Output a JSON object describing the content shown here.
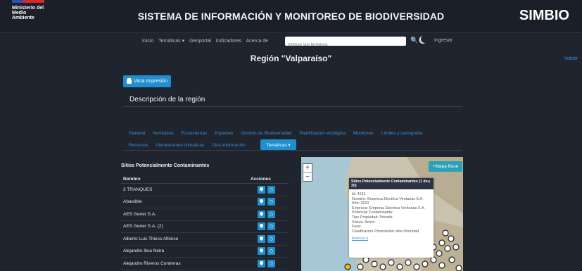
{
  "header": {
    "ministry_lines": [
      "Ministerio del",
      "Medio",
      "Ambiente"
    ],
    "title": "SISTEMA DE INFORMACIÓN Y MONITOREO DE BIODIVERSIDAD",
    "brand": "SIMBIO"
  },
  "nav": {
    "items": [
      "Inicio",
      "Temáticas ▾",
      "Geoportal",
      "Indicadores",
      "Acerca de"
    ],
    "search_placeholder": "Ingrese sus términos.",
    "login": "Ingresar"
  },
  "page": {
    "title": "Región \"Valparaíso\"",
    "back": "Volver",
    "print_button": "Vista Impresión",
    "section_title": "Descripción de la región"
  },
  "tabs": {
    "row1": [
      "General",
      "Normativa",
      "Ecosistemas",
      "Especies",
      "Gestión de Biodiversidad",
      "Planificación ecológica",
      "Monitoreo",
      "Límites y cartografía"
    ],
    "row2": [
      "Recursos",
      "Simulaciones climáticas",
      "Otra información"
    ],
    "active": "Temáticas ▾"
  },
  "table": {
    "title": "Sitios Potencialmente Contaminantes",
    "headers": [
      "Nombre",
      "Acciones"
    ],
    "rows": [
      "3 TRANQUES",
      "Abastible",
      "AES Gener S.A.",
      "AES Gener S.A. (2)",
      "Alberto Luis Thiess Alfonso",
      "Alejandro Ilica Neira",
      "Alejandro Riveros Contreras"
    ]
  },
  "map": {
    "zoom_in": "+",
    "zoom_out": "−",
    "basemap_button": "+Mapa Base",
    "popup": {
      "title": "Sitios Potencialmente Contaminantes (1 de 20)",
      "close": "✕",
      "lines": [
        "Id: 4131",
        "Nombre: Empresa Electrica Ventanas S.A.",
        "Año: 2022",
        "Empresa: Empresa Electrica Ventanas S.A.",
        "Potencial Contaminante:",
        "Tipo Propiedad: Privada",
        "Status: Activo",
        "Fase:",
        "Clasificación Priorización: Alta Prioridad"
      ],
      "link": "Acercar a"
    }
  }
}
